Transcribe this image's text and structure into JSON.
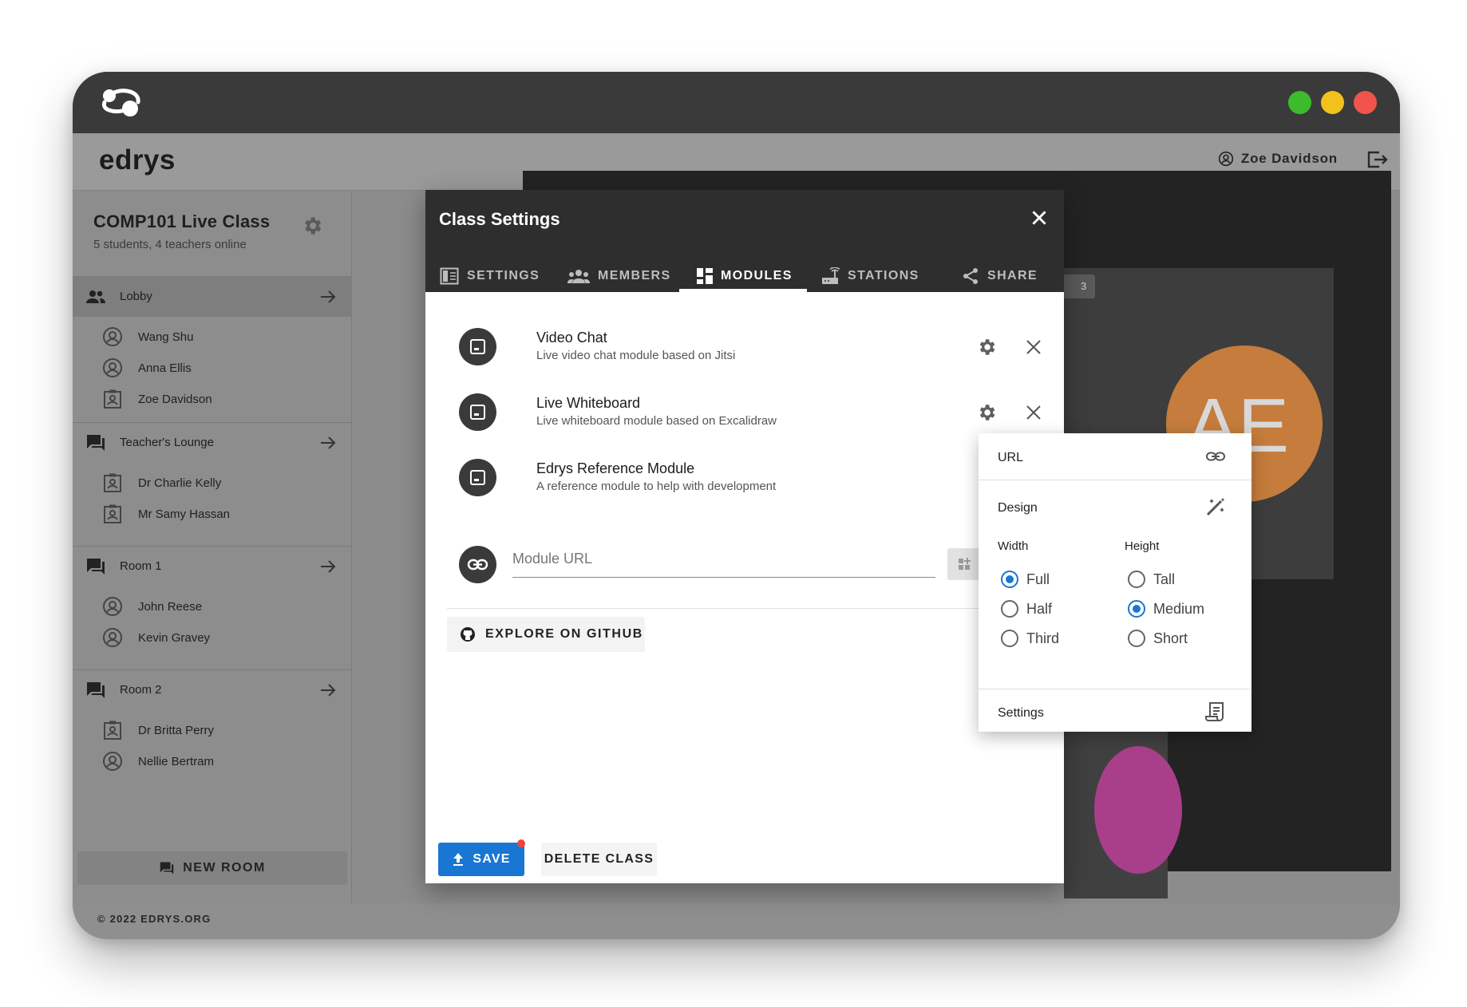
{
  "app": {
    "brand": "edrys",
    "user": "Zoe Davidson",
    "footer": "© 2022 EDRYS.ORG"
  },
  "traffic_colors": [
    "#3cbc2c",
    "#f2c11c",
    "#f2534c"
  ],
  "sidebar": {
    "class_title": "COMP101 Live Class",
    "class_subtitle": "5 students, 4 teachers online",
    "rooms": [
      {
        "label": "Lobby",
        "icon": "people-icon",
        "members": [
          {
            "name": "Wang Shu",
            "icon": "account-circle-icon"
          },
          {
            "name": "Anna Ellis",
            "icon": "account-circle-icon"
          },
          {
            "name": "Zoe Davidson",
            "icon": "badge-icon"
          }
        ]
      },
      {
        "label": "Teacher's Lounge",
        "icon": "forum-icon",
        "members": [
          {
            "name": "Dr Charlie Kelly",
            "icon": "badge-icon"
          },
          {
            "name": "Mr Samy Hassan",
            "icon": "badge-icon"
          }
        ]
      },
      {
        "label": "Room 1",
        "icon": "forum-icon",
        "members": [
          {
            "name": "John Reese",
            "icon": "account-circle-icon"
          },
          {
            "name": "Kevin Gravey",
            "icon": "account-circle-icon"
          }
        ]
      },
      {
        "label": "Room 2",
        "icon": "forum-icon",
        "members": [
          {
            "name": "Dr Britta Perry",
            "icon": "badge-icon"
          },
          {
            "name": "Nellie Bertram",
            "icon": "account-circle-icon"
          }
        ]
      }
    ],
    "new_room_label": "NEW ROOM"
  },
  "video": {
    "participant_count": "3",
    "avatar_initials": "AE"
  },
  "modal": {
    "title": "Class Settings",
    "tabs": [
      "SETTINGS",
      "MEMBERS",
      "MODULES",
      "STATIONS",
      "SHARE"
    ],
    "active_tab": "MODULES",
    "modules": [
      {
        "name": "Video Chat",
        "description": "Live video chat module based on Jitsi"
      },
      {
        "name": "Live Whiteboard",
        "description": "Live whiteboard module based on Excalidraw"
      },
      {
        "name": "Edrys Reference Module",
        "description": "A reference module to help with development"
      }
    ],
    "module_url_placeholder": "Module URL",
    "github_label": "EXPLORE ON GITHUB",
    "save_label": "SAVE",
    "delete_label": "DELETE CLASS"
  },
  "popup": {
    "url_label": "URL",
    "design_label": "Design",
    "width_label": "Width",
    "height_label": "Height",
    "width_options": [
      "Full",
      "Half",
      "Third"
    ],
    "width_selected": "Full",
    "height_options": [
      "Tall",
      "Medium",
      "Short"
    ],
    "height_selected": "Medium",
    "settings_label": "Settings"
  }
}
